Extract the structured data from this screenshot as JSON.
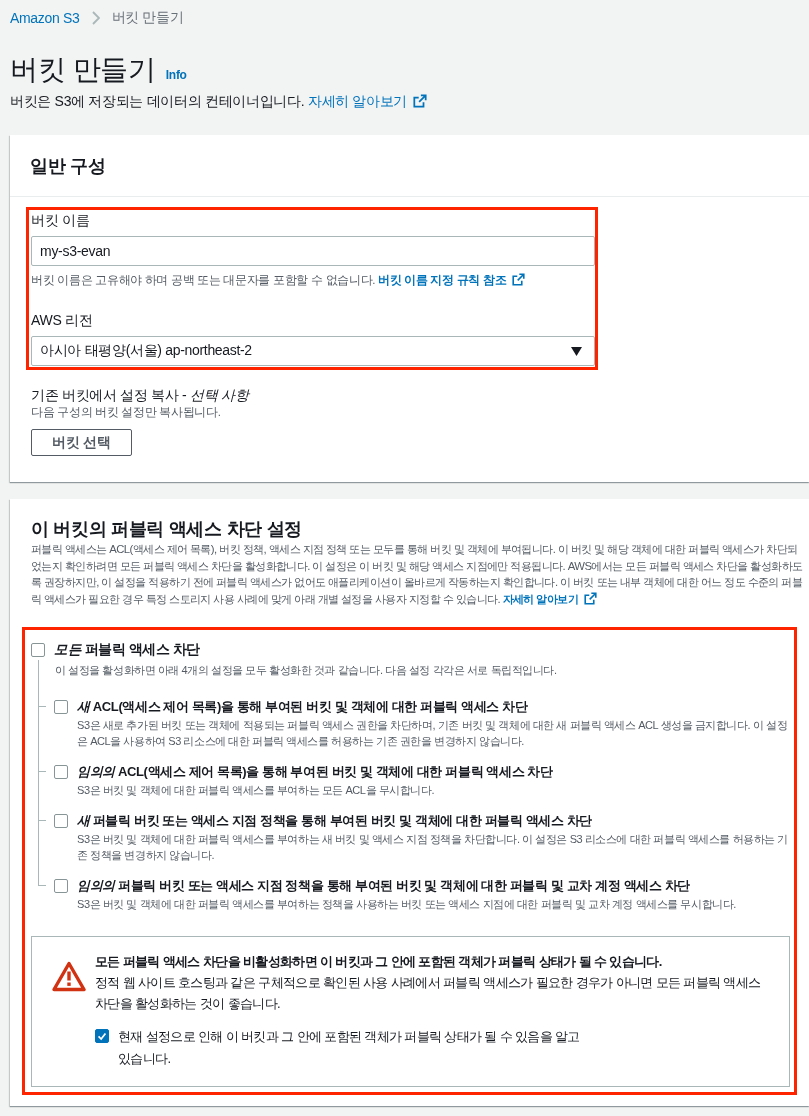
{
  "breadcrumb": [
    {
      "label": "Amazon S3",
      "kind": "link"
    },
    {
      "label": "버킷 만들기",
      "kind": "current"
    }
  ],
  "page": {
    "title": "버킷 만들기",
    "info": "Info",
    "description": "버킷은 S3에 저장되는 데이터의 컨테이너입니다.",
    "link": "자세히 알아보기"
  },
  "general": {
    "title": "일반 구성",
    "highlighted": true,
    "fields": [
      {
        "kind": "text",
        "label": "버킷 이름",
        "value": "my-s3-evan",
        "hint": "버킷 이름은 고유해야 하며 공백 또는 대문자를 포함할 수 없습니다.",
        "hint_link": "버킷 이름 지정 규칙 참조"
      },
      {
        "kind": "select",
        "label": "AWS 리전",
        "value": "아시아 태평양(서울) ap-northeast-2"
      }
    ],
    "copy_settings": {
      "label": "기존 버킷에서 설정 복사 - *선택 사항*",
      "description": "다음 구성의 버킷 설정만 복사됩니다.",
      "button": "버킷 선택"
    }
  },
  "public_access": {
    "title": "이 버킷의 퍼블릭 액세스 차단 설정",
    "description": "퍼블릭 액세스는 ACL(액세스 제어 목록), 버킷 정책, 액세스 지점 정책 또는 모두를 통해 버킷 및 객체에 부여됩니다. 이 버킷 및 해당 객체에 대한 퍼블릭 액세스가 차단되었는지 확인하려면 모든 퍼블릭 액세스 차단을 활성화합니다. 이 설정은 이 버킷 및 해당 액세스 지점에만 적용됩니다. AWS에서는 모든 퍼블릭 액세스 차단을 활성화하도록 권장하지만, 이 설정을 적용하기 전에 퍼블릭 액세스가 없어도 애플리케이션이 올바르게 작동하는지 확인합니다. 이 버킷 또는 내부 객체에 대한 어느 정도 수준의 퍼블릭 액세스가 필요한 경우 특정 스토리지 사용 사례에 맞게 아래 개별 설정을 사용자 지정할 수 있습니다.",
    "link": "자세히 알아보기",
    "highlighted": true,
    "block_all": {
      "label": "*모든* 퍼블릭 액세스 차단",
      "description": "이 설정을 활성화하면 아래 4개의 설정을 모두 활성화한 것과 같습니다. 다음 설정 각각은 서로 독립적입니다.",
      "checked": false,
      "children": [
        {
          "label": "*새* ACL(액세스 제어 목록)을 통해 부여된 버킷 및 객체에 대한 퍼블릭 액세스 차단",
          "description": "S3은 새로 추가된 버킷 또는 객체에 적용되는 퍼블릭 액세스 권한을 차단하며, 기존 버킷 및 객체에 대한 새 퍼블릭 액세스 ACL 생성을 금지합니다. 이 설정은 ACL을 사용하여 S3 리소스에 대한 퍼블릭 액세스를 허용하는 기존 권한을 변경하지 않습니다.",
          "checked": false
        },
        {
          "label": "*임의의* ACL(액세스 제어 목록)을 통해 부여된 버킷 및 객체에 대한 퍼블릭 액세스 차단",
          "description": "S3은 버킷 및 객체에 대한 퍼블릭 액세스를 부여하는 모든 ACL을 무시합니다.",
          "checked": false
        },
        {
          "label": "*새* 퍼블릭 버킷 또는 액세스 지점 정책을 통해 부여된 버킷 및 객체에 대한 퍼블릭 액세스 차단",
          "description": "S3은 버킷 및 객체에 대한 퍼블릭 액세스를 부여하는 새 버킷 및 액세스 지점 정책을 차단합니다. 이 설정은 S3 리소스에 대한 퍼블릭 액세스를 허용하는 기존 정책을 변경하지 않습니다.",
          "checked": false
        },
        {
          "label": "*임의의* 퍼블릭 버킷 또는 액세스 지점 정책을 통해 부여된 버킷 및 객체에 대한 퍼블릭 및 교차 계정 액세스 차단",
          "description": "S3은 버킷 및 객체에 대한 퍼블릭 액세스를 부여하는 정책을 사용하는 버킷 또는 액세스 지점에 대한 퍼블릭 및 교차 계정 액세스를 무시합니다.",
          "checked": false
        }
      ]
    },
    "warning": {
      "title": "모든 퍼블릭 액세스 차단을 비활성화하면 이 버킷과 그 안에 포함된 객체가 퍼블릭 상태가 될 수 있습니다.",
      "body": "정적 웹 사이트 호스팅과 같은 구체적으로 확인된 사용 사례에서 퍼블릭 액세스가 필요한 경우가 아니면 모든 퍼블릭 액세스 차단을 활성화하는 것이 좋습니다.",
      "acknowledge": {
        "label": "현재 설정으로 인해 이 버킷과 그 안에 포함된 객체가 퍼블릭 상태가 될 수 있음을 알고 있습니다.",
        "checked": true
      }
    }
  }
}
